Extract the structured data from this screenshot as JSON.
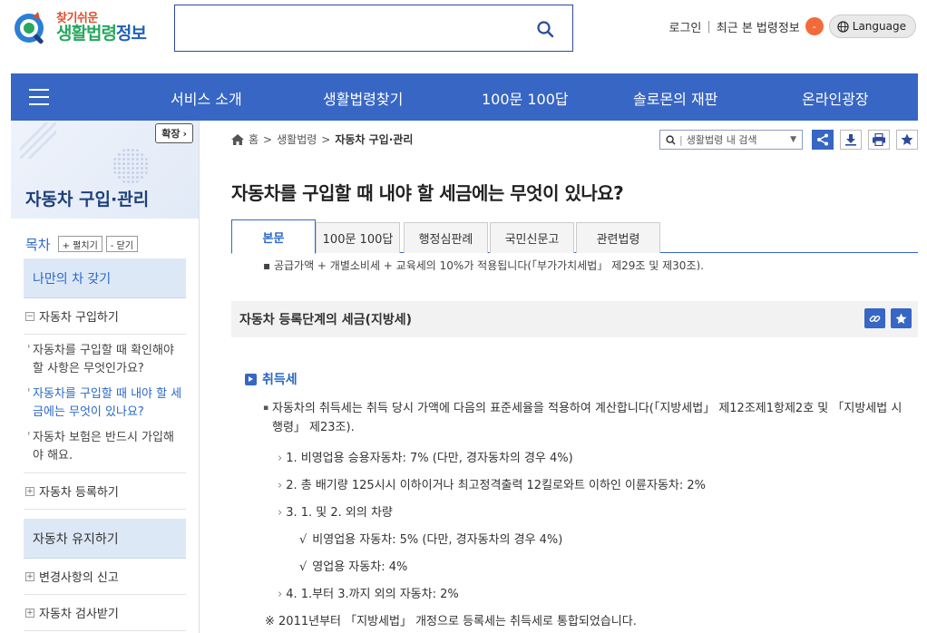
{
  "header": {
    "logo_small": "찾기쉬운",
    "logo_big_a": "생활법령",
    "logo_big_b": "정보",
    "search_placeholder": "",
    "util": {
      "login": "로그인",
      "recent": "최근 본 법령정보",
      "recent_count": "-",
      "language": "Language"
    }
  },
  "nav": {
    "items": [
      "서비스 소개",
      "생활법령찾기",
      "100문 100답",
      "솔로몬의 재판",
      "온라인광장"
    ]
  },
  "sidebar": {
    "expand_label": "확장",
    "title": "자동차 구입·관리",
    "toc_label": "목차",
    "expand_all": "+ 펼치기",
    "collapse_all": "- 닫기",
    "cat1": "나만의 차 갖기",
    "sub1": "자동차 구입하기",
    "leaf1": "자동차를 구입할 때 확인해야 할 사항은 무엇인가요?",
    "leaf2": "자동차를 구입할 때 내야 할 세금에는 무엇이 있나요?",
    "leaf3": "자동차 보험은 반드시 가입해야 해요.",
    "sub2": "자동차 등록하기",
    "cat2": "자동차 유지하기",
    "sub3": "변경사항의 신고",
    "sub4": "자동차 검사받기"
  },
  "breadcrumb": {
    "home": "홈",
    "level1": "생활법령",
    "current": "자동차 구입·관리"
  },
  "local_search": {
    "placeholder": "생활법령 내 검색"
  },
  "main": {
    "title": "자동차를 구입할 때 내야 할 세금에는 무엇이 있나요?",
    "tabs": [
      "본문",
      "100문 100답",
      "행정심판례",
      "국민신문고",
      "관련법령"
    ],
    "cut_line": "▪ 공급가액 + 개별소비세 + 교육세의 10%가 적용됩니다(「부가가치세법」 제29조 및 제30조).",
    "section_title": "자동차 등록단계의 세금(지방세)",
    "subheading": "취득세",
    "paragraph": "자동차의 취득세는 취득 당시 가액에 다음의 표준세율을 적용하여 계산합니다(「지방세법」 제12조제1항제2호 및 「지방세법 시행령」 제23조).",
    "list": [
      "1. 비영업용 승용자동차: 7% (다만, 경자동차의 경우 4%)",
      "2. 총 배기량 125시시 이하이거나 최고정격출력 12킬로와트 이하인 이륜자동차: 2%",
      "3. 1. 및 2. 외의 차량",
      "4. 1.부터 3.까지 외의 자동차: 2%"
    ],
    "checks": [
      "비영업용 자동차: 5% (다만, 경자동차의 경우 4%)",
      "영업용 자동차: 4%"
    ],
    "note": "※ 2011년부터 「지방세법」 개정으로 등록세는 취득세로 통합되었습니다."
  },
  "colors": {
    "primary": "#3766c4",
    "accent": "#2b68c6",
    "badge": "#f36b3b"
  }
}
